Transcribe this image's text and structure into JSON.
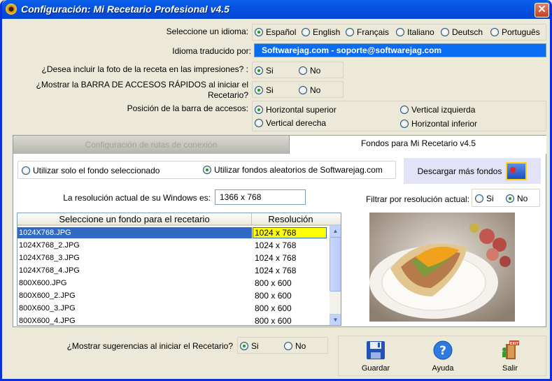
{
  "window": {
    "title": "Configuración: Mi Recetario Profesional v4.5",
    "close_glyph": "✕",
    "icon": "app-sun-icon"
  },
  "language": {
    "label": "Seleccione un idioma:",
    "options": [
      "Español",
      "English",
      "Français",
      "Italiano",
      "Deutsch",
      "Português"
    ],
    "selected": "Español"
  },
  "translated_by": {
    "label": "Idioma traducido por:",
    "value": "Softwarejag.com - soporte@softwarejag.com"
  },
  "include_photo": {
    "label": "¿Desea incluir la foto de la receta en las impresiones? :",
    "yes": "Si",
    "no": "No",
    "selected": "Si"
  },
  "quick_bar": {
    "label_line1": "¿Mostrar la BARRA DE ACCESOS RÁPIDOS al iniciar el",
    "label_line2": "Recetario?",
    "yes": "Si",
    "no": "No",
    "selected": "Si"
  },
  "bar_position": {
    "label": "Posición de la barra de accesos:",
    "options": [
      "Horizontal superior",
      "Vertical izquierda",
      "Vertical derecha",
      "Horizontal inferior"
    ],
    "selected": "Horizontal superior"
  },
  "tabs": {
    "inactive": "Configuración de rutas de conexión",
    "active": "Fondos para Mi Recetario v4.5"
  },
  "background_mode": {
    "opt_selected_only": "Utilizar solo el fondo seleccionado",
    "opt_random": "Utilizar fondos aleatorios de Softwarejag.com",
    "selected": "random"
  },
  "download_button": {
    "label": "Descargar más fondos",
    "icon": "download-backgrounds-icon"
  },
  "resolution": {
    "label": "La resolución actual de su Windows es:",
    "value": "1366 x 768"
  },
  "filter": {
    "label": "Filtrar por resolución actual:",
    "yes": "Si",
    "no": "No",
    "selected": "No"
  },
  "backgrounds_table": {
    "headers": [
      "Seleccione un fondo para el recetario",
      "Resolución"
    ],
    "rows": [
      [
        "1024X768.JPG",
        "1024 x 768"
      ],
      [
        "1024X768_2.JPG",
        "1024 x 768"
      ],
      [
        "1024X768_3.JPG",
        "1024 x 768"
      ],
      [
        "1024X768_4.JPG",
        "1024 x 768"
      ],
      [
        "800X600.JPG",
        "800 x 600"
      ],
      [
        "800X600_2.JPG",
        "800 x 600"
      ],
      [
        "800X600_3.JPG",
        "800 x 600"
      ],
      [
        "800X600_4.JPG",
        "800 x 600"
      ]
    ],
    "selected_index": 0
  },
  "suggestions": {
    "label": "¿Mostrar sugerencias al iniciar el Recetario?",
    "yes": "Si",
    "no": "No",
    "selected": "Si"
  },
  "actions": {
    "save": "Guardar",
    "help": "Ayuda",
    "exit": "Salir",
    "exit_sign": "EXIT"
  },
  "colors": {
    "title_bar": "#0553E2",
    "field_blue": "#0A6CF0",
    "selection": "#316AC5",
    "highlight_yellow": "#FFFF00"
  }
}
